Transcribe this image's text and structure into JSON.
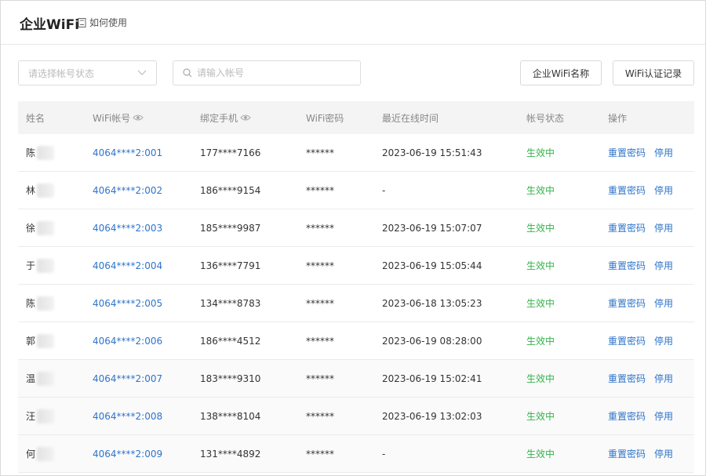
{
  "header": {
    "title": "企业WiFi",
    "help_label": "如何使用"
  },
  "filters": {
    "status_placeholder": "请选择帐号状态",
    "search_placeholder": "请输入帐号",
    "btn_wifi_name": "企业WiFi名称",
    "btn_auth_log": "WiFi认证记录"
  },
  "table": {
    "headers": {
      "name": "姓名",
      "account": "WiFi帐号",
      "phone": "绑定手机",
      "password": "WiFi密码",
      "last_online": "最近在线时间",
      "status": "帐号状态",
      "actions": "操作"
    },
    "action_reset": "重置密码",
    "action_disable": "停用",
    "rows": [
      {
        "name": "陈",
        "account": "4064****2:001",
        "phone": "177****7166",
        "password": "******",
        "last_online": "2023-06-19 15:51:43",
        "status": "生效中"
      },
      {
        "name": "林",
        "account": "4064****2:002",
        "phone": "186****9154",
        "password": "******",
        "last_online": "-",
        "status": "生效中"
      },
      {
        "name": "徐",
        "account": "4064****2:003",
        "phone": "185****9987",
        "password": "******",
        "last_online": "2023-06-19 15:07:07",
        "status": "生效中"
      },
      {
        "name": "于",
        "account": "4064****2:004",
        "phone": "136****7791",
        "password": "******",
        "last_online": "2023-06-19 15:05:44",
        "status": "生效中"
      },
      {
        "name": "陈",
        "account": "4064****2:005",
        "phone": "134****8783",
        "password": "******",
        "last_online": "2023-06-18 13:05:23",
        "status": "生效中"
      },
      {
        "name": "郭",
        "account": "4064****2:006",
        "phone": "186****4512",
        "password": "******",
        "last_online": "2023-06-19 08:28:00",
        "status": "生效中"
      },
      {
        "name": "温",
        "account": "4064****2:007",
        "phone": "183****9310",
        "password": "******",
        "last_online": "2023-06-19 15:02:41",
        "status": "生效中"
      },
      {
        "name": "汪",
        "account": "4064****2:008",
        "phone": "138****8104",
        "password": "******",
        "last_online": "2023-06-19 13:02:03",
        "status": "生效中"
      },
      {
        "name": "何",
        "account": "4064****2:009",
        "phone": "131****4892",
        "password": "******",
        "last_online": "-",
        "status": "生效中"
      }
    ]
  },
  "colors": {
    "link": "#2f74c9",
    "status_active": "#34b34a",
    "header_bg": "#f4f4f5"
  }
}
